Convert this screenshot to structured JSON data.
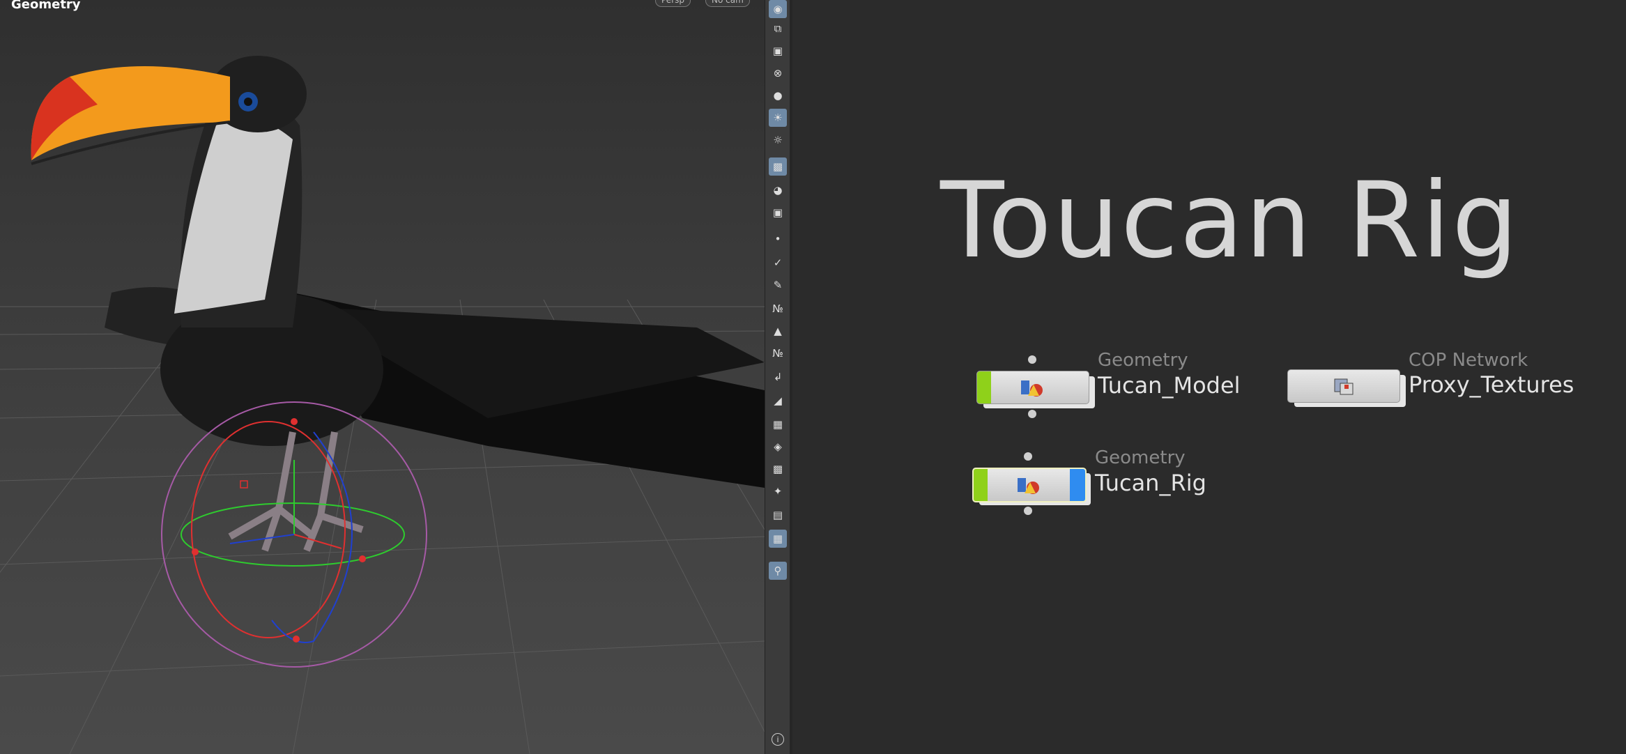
{
  "viewport": {
    "title": "Geometry",
    "pills": [
      "Persp",
      "No cam"
    ]
  },
  "toolbar": {
    "tools": [
      "display-options-icon",
      "snap-icon",
      "lock-icon",
      "close-x-icon",
      "sphere-icon",
      "light-bulb-icon",
      "bulb-outline-icon",
      "camera-icon",
      "eye-icon",
      "camera2-icon",
      "point-icon",
      "brush-icon",
      "pen-icon",
      "numbers-icon",
      "paint-icon",
      "numbers2-icon",
      "curve-icon",
      "shape-icon",
      "checker-icon",
      "layers-icon",
      "map-icon",
      "joint-icon",
      "list-icon",
      "image-icon",
      "pin-icon",
      "info-icon"
    ],
    "info_label": "i"
  },
  "network": {
    "title": "Toucan Rig",
    "nodes": [
      {
        "type": "Geometry",
        "name": "Tucan_Model"
      },
      {
        "type": "COP Network",
        "name": "Proxy_Textures"
      },
      {
        "type": "Geometry",
        "name": "Tucan_Rig"
      }
    ]
  },
  "colors": {
    "node_green": "#8fd11a",
    "node_blue": "#2f8cf0",
    "beak_orange": "#f39a1c",
    "beak_red": "#d9331f"
  }
}
